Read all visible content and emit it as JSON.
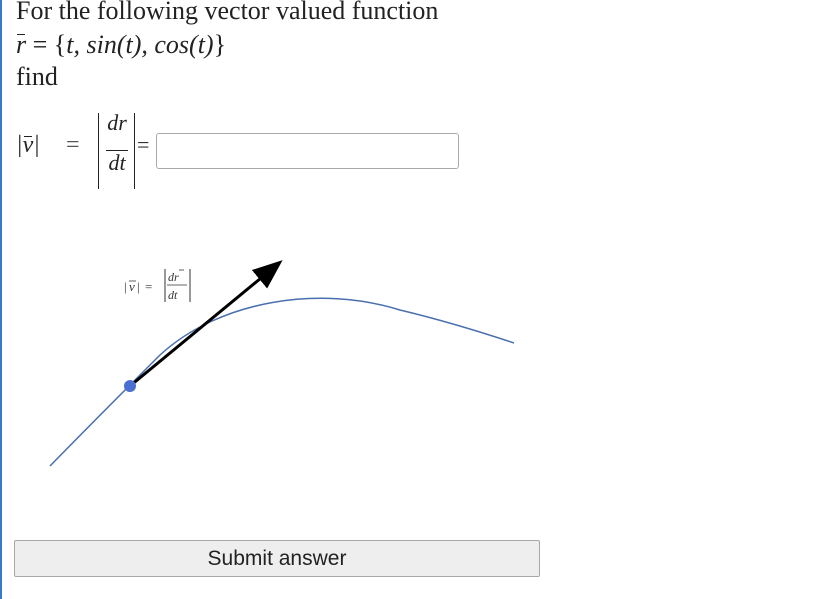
{
  "problem": {
    "intro": "For the following vector valued function",
    "function_lhs": "r",
    "function_eq": " = ",
    "function_rhs_open": "{",
    "function_rhs_body": "t, sin(t), cos(t)",
    "function_rhs_close": "}",
    "prompt": "find"
  },
  "formula": {
    "v_symbol": "v",
    "equals": "=",
    "numerator": "dr",
    "denominator": "dt",
    "equals2": "="
  },
  "answer": {
    "value": "",
    "placeholder": ""
  },
  "diagram": {
    "label_v": "v",
    "label_numerator": "dr",
    "label_denominator": "dt",
    "curve_color": "#4a6fb0",
    "point_color": "#4a6fd0",
    "arrow_color": "#000000"
  },
  "submit": {
    "label": "Submit answer"
  }
}
